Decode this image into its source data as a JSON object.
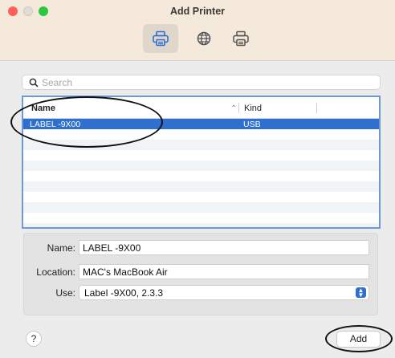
{
  "window": {
    "title": "Add Printer"
  },
  "toolbar": {
    "items": [
      "default-printer-icon",
      "ip-printer-icon",
      "windows-printer-icon"
    ]
  },
  "search": {
    "placeholder": "Search"
  },
  "list": {
    "columns": {
      "name": "Name",
      "kind": "Kind"
    },
    "rows": [
      {
        "name": "LABEL -9X00",
        "kind": "USB",
        "selected": true
      }
    ]
  },
  "details": {
    "name_label": "Name:",
    "name_value": "LABEL -9X00",
    "location_label": "Location:",
    "location_value": "MAC's MacBook Air",
    "use_label": "Use:",
    "use_value": "Label -9X00, 2.3.3"
  },
  "buttons": {
    "help": "?",
    "add": "Add"
  },
  "colors": {
    "selection": "#2f6fd0",
    "focus_ring": "#6b9ad6",
    "titlebar": "#f4e9da"
  }
}
